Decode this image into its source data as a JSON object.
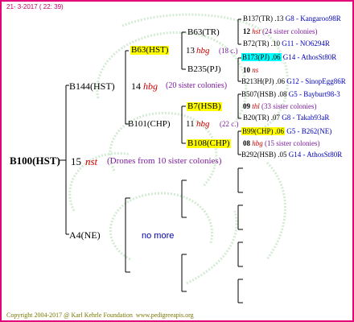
{
  "header": {
    "date": "21- 3-2017 ( 22: 39)"
  },
  "tree": {
    "root": {
      "name": "B100(HST)",
      "gen": "15",
      "line": "nst",
      "note": "(Drones from 10 sister colonies)"
    },
    "sire": {
      "name": "B144(HST)",
      "gen": "14",
      "line": "hbg",
      "note": "(20 sister colonies)"
    },
    "dam": {
      "name": "A4(NE)",
      "note": "no more"
    },
    "ss": {
      "name": "B63(HST)",
      "gen": "13",
      "line": "hbg",
      "note": "(18 c.)"
    },
    "sd": {
      "name": "B101(CHP)",
      "gen": "11",
      "line": "hbg",
      "note": "(22 c.)"
    },
    "sss": {
      "name": "B63(TR)"
    },
    "ssd": {
      "name": "B235(PJ)"
    },
    "sds": {
      "name": "B7(HSB)"
    },
    "sdd": {
      "name": "B108(CHP)"
    },
    "gen4": [
      {
        "name": "B137(TR)",
        "num": ".13",
        "code": "G8 - Kangaroo98R"
      },
      {
        "gen": "12",
        "line": "hst",
        "note": "(24 sister colonies)"
      },
      {
        "name": "B72(TR)",
        "num": ".10",
        "code": "G11 - NO6294R"
      },
      {
        "name": "B173(PJ)",
        "num": ".06",
        "code": "G14 - AthosSt80R"
      },
      {
        "gen": "10",
        "line": "ns"
      },
      {
        "name": "B213H(PJ)",
        "num": ".06",
        "code": "G12 - SinopEgg86R"
      },
      {
        "name": "B507(HSB)",
        "num": ".08",
        "code": "G5 - Bayburt98-3"
      },
      {
        "gen": "09",
        "line": "thl",
        "note": "(33 sister colonies)"
      },
      {
        "name": "B20(TR)",
        "num": ".07",
        "code": "G8 - Takab93aR"
      },
      {
        "name": "B99(CHP)",
        "num": ".06",
        "code": "G5 - B262(NE)"
      },
      {
        "gen": "08",
        "line": "hbg",
        "note": "(15 sister colonies)"
      },
      {
        "name": "B292(HSB)",
        "num": ".05",
        "code": "G14 - AthosSt80R"
      }
    ]
  },
  "footer": {
    "copyright": "Copyright 2004-2017 @ Karl Kehrle Foundation",
    "url": "www.pedigreeapis.org"
  },
  "colors": {
    "border": "#e3007b",
    "highlight_yellow": "#ffff00",
    "highlight_cyan": "#00ffff",
    "link_blue": "#0000bb"
  }
}
